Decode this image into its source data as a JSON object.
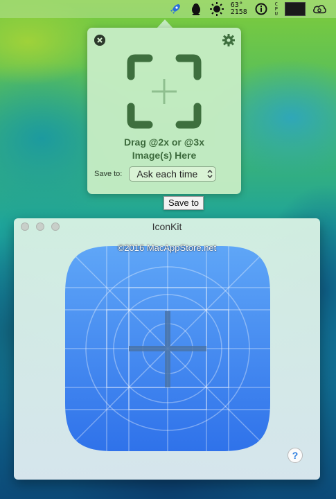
{
  "menubar": {
    "items": [
      {
        "icon": "rocket-icon"
      },
      {
        "icon": "penguin-icon"
      },
      {
        "icon": "sun-icon"
      },
      {
        "icon": "info-icon"
      },
      {
        "icon": "cpu-graph-icon"
      },
      {
        "icon": "creative-cloud-icon"
      }
    ],
    "weather_temp": "63°",
    "weather_value": "2158",
    "cpu_letters": [
      "C",
      "P",
      "U"
    ]
  },
  "popover": {
    "drop_text_line1": "Drag @2x or @3x",
    "drop_text_line2": "Image(s) Here",
    "save_label": "Save to:",
    "save_value": "Ask each time",
    "accent_color": "#3e6f3e"
  },
  "tooltip": {
    "text": "Save to"
  },
  "window": {
    "title": "IconKit",
    "watermark": "©2016 MacAppStore.net",
    "help_label": "?",
    "icon_color_top": "#5fa6f7",
    "icon_color_bottom": "#2f72ea"
  }
}
